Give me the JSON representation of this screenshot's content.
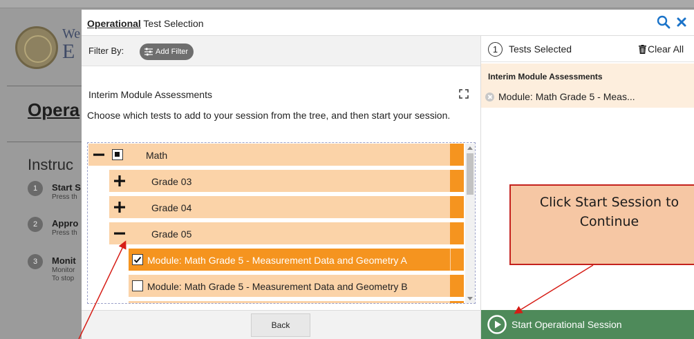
{
  "background": {
    "brand_line1": "We",
    "brand_line2": "E",
    "heading": "Opera",
    "instructions_heading": "Instruc",
    "steps": [
      {
        "num": "1",
        "title": "Start S",
        "desc": "Press th"
      },
      {
        "num": "2",
        "title": "Appro",
        "desc": "Press th"
      },
      {
        "num": "3",
        "title": "Monit",
        "desc": "Monitor",
        "desc2": "To stop"
      }
    ]
  },
  "modal": {
    "title_bold": "Operational",
    "title_rest": " Test Selection",
    "search_icon": "search-icon",
    "close_icon": "close-icon"
  },
  "filter": {
    "label": "Filter By:",
    "add_filter": "Add Filter"
  },
  "category": {
    "title": "Interim Module Assessments",
    "instructions": "Choose which tests to add to your session from the tree, and then start your session."
  },
  "tree": {
    "rows": [
      {
        "label": "Math",
        "toggle": "minus",
        "checkbox": "partial"
      },
      {
        "label": "Grade 03",
        "toggle": "plus"
      },
      {
        "label": "Grade 04",
        "toggle": "plus"
      },
      {
        "label": "Grade 05",
        "toggle": "minus"
      },
      {
        "label": "Module: Math Grade 5 - Measurement Data and Geometry A",
        "checkbox": "checked",
        "selected": true
      },
      {
        "label": "Module: Math Grade 5 - Measurement Data and Geometry B",
        "checkbox": "unchecked"
      }
    ]
  },
  "footer": {
    "back_label": "Back"
  },
  "selected": {
    "count": "1",
    "label": "Tests Selected",
    "clear_all": "Clear All",
    "group_title": "Interim Module Assessments",
    "items": [
      "Module: Math Grade 5 - Meas..."
    ]
  },
  "start_button": {
    "label": "Start Operational Session"
  },
  "callout": {
    "line1": "Click Start Session to",
    "line2": "Continue"
  },
  "colors": {
    "accent_orange": "#f5941f",
    "light_orange": "#fbd3a8",
    "start_green": "#4e8a5a",
    "callout_border": "#c4211d",
    "callout_fill": "#f6c7a4"
  }
}
